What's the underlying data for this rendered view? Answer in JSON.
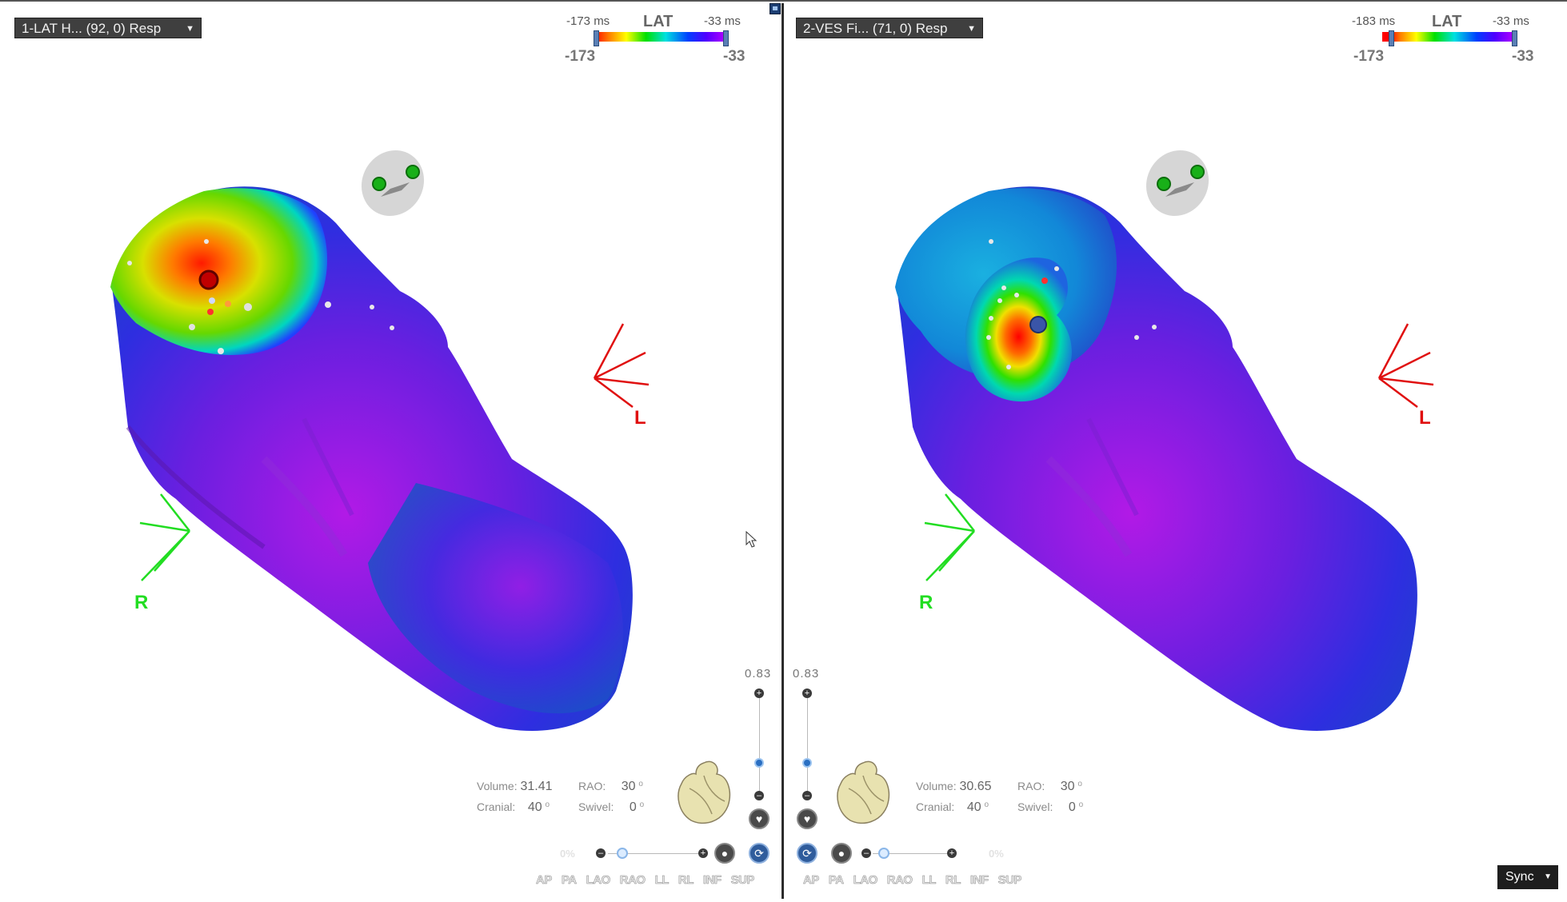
{
  "left_pane": {
    "map_name": "1-LAT H... (92, 0) Resp",
    "scale": {
      "title": "LAT",
      "min_ms": "-173 ms",
      "max_ms": "-33 ms",
      "min_val": "-173",
      "max_val": "-33"
    },
    "stats": {
      "volume_label": "Volume:",
      "volume": "31.41",
      "cranial_label": "Cranial:",
      "cranial": "40",
      "rao_label": "RAO:",
      "rao": "30",
      "swivel_label": "Swivel:",
      "swivel": "0",
      "degree": "o"
    },
    "zoom_value": "0.83",
    "orientation_labels": {
      "left": "L",
      "right": "R"
    },
    "views": [
      "AP",
      "PA",
      "LAO",
      "RAO",
      "LL",
      "RL",
      "INF",
      "SUP"
    ]
  },
  "right_pane": {
    "map_name": "2-VES Fi... (71, 0) Resp",
    "scale": {
      "title": "LAT",
      "min_ms": "-183 ms",
      "max_ms": "-33 ms",
      "min_val": "-173",
      "max_val": "-33"
    },
    "stats": {
      "volume_label": "Volume:",
      "volume": "30.65",
      "cranial_label": "Cranial:",
      "cranial": "40",
      "rao_label": "RAO:",
      "rao": "30",
      "swivel_label": "Swivel:",
      "swivel": "0",
      "degree": "o"
    },
    "zoom_value": "0.83",
    "orientation_labels": {
      "left": "L",
      "right": "R"
    },
    "views": [
      "AP",
      "PA",
      "LAO",
      "RAO",
      "LL",
      "RL",
      "INF",
      "SUP"
    ]
  },
  "sync": {
    "label": "Sync"
  },
  "colors": {
    "orientation_left": "#e01010",
    "orientation_right": "#22dd22",
    "early": "#ff0000",
    "late": "#b000ff"
  }
}
